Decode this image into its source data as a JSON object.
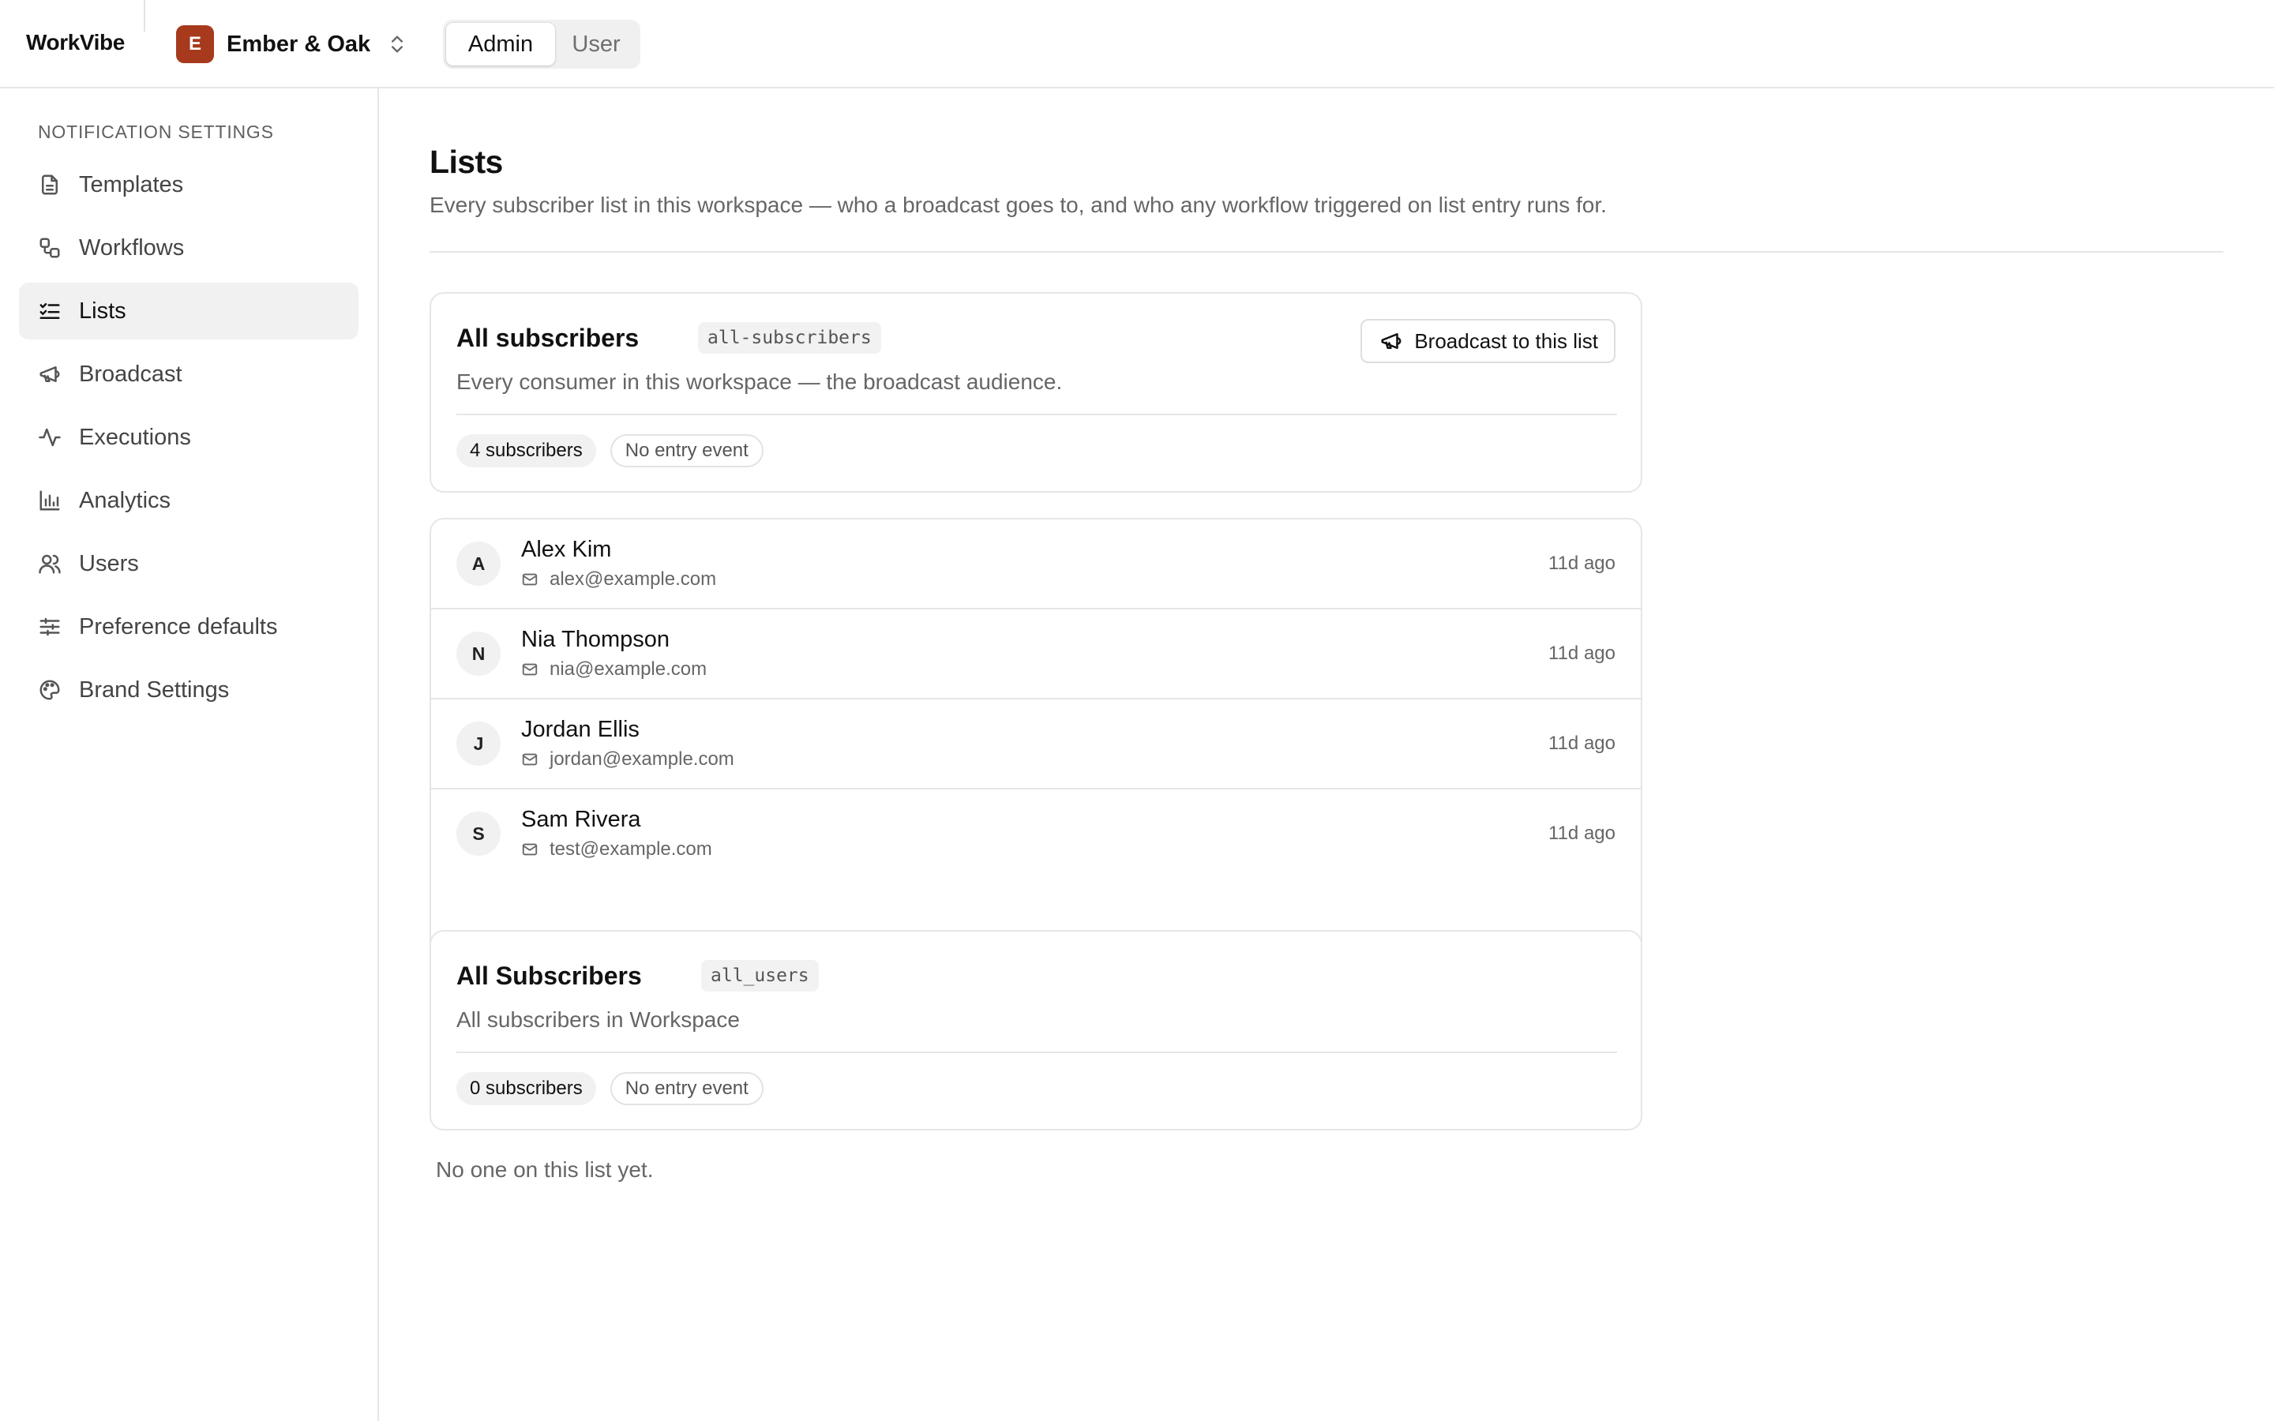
{
  "app": {
    "brand": "WorkVibe",
    "workspace": {
      "initial": "E",
      "name": "Ember & Oak",
      "color": "#a73a1d"
    },
    "roles": {
      "admin": "Admin",
      "user": "User",
      "active": "Admin"
    }
  },
  "sidebar": {
    "heading": "Notification Settings",
    "items": [
      {
        "label": "Templates",
        "icon": "file-text-icon"
      },
      {
        "label": "Workflows",
        "icon": "workflow-icon"
      },
      {
        "label": "Lists",
        "icon": "list-checks-icon",
        "active": true
      },
      {
        "label": "Broadcast",
        "icon": "megaphone-icon"
      },
      {
        "label": "Executions",
        "icon": "activity-icon"
      },
      {
        "label": "Analytics",
        "icon": "bar-chart-icon"
      },
      {
        "label": "Users",
        "icon": "users-icon"
      },
      {
        "label": "Preference defaults",
        "icon": "sliders-icon"
      },
      {
        "label": "Brand Settings",
        "icon": "palette-icon"
      }
    ]
  },
  "main": {
    "title": "Lists",
    "subtitle": "Every subscriber list in this workspace — who a broadcast goes to, and who any workflow triggered on list entry runs for.",
    "lists": [
      {
        "name": "All subscribers",
        "key": "all-subscribers",
        "description": "Every consumer in this workspace — the broadcast audience.",
        "count_label": "4 subscribers",
        "entry_label": "No entry event",
        "broadcast_label": "Broadcast to this list",
        "subscribers": [
          {
            "initial": "A",
            "name": "Alex Kim",
            "email": "alex@example.com",
            "time": "11d ago"
          },
          {
            "initial": "N",
            "name": "Nia Thompson",
            "email": "nia@example.com",
            "time": "11d ago"
          },
          {
            "initial": "J",
            "name": "Jordan Ellis",
            "email": "jordan@example.com",
            "time": "11d ago"
          },
          {
            "initial": "S",
            "name": "Sam Rivera",
            "email": "test@example.com",
            "time": "11d ago"
          }
        ]
      },
      {
        "name": "All Subscribers",
        "key": "all_users",
        "description": "All subscribers in Workspace",
        "count_label": "0 subscribers",
        "entry_label": "No entry event",
        "empty_text": "No one on this list yet."
      }
    ]
  }
}
